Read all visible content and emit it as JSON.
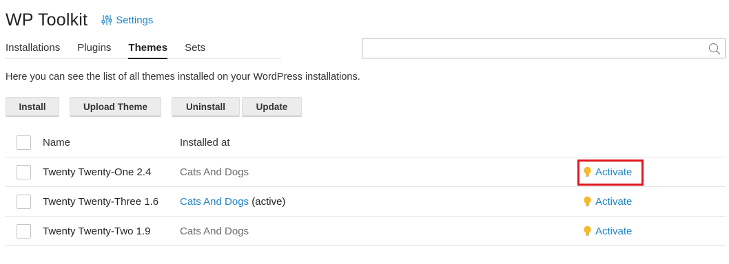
{
  "header": {
    "title": "WP Toolkit",
    "settings_label": "Settings"
  },
  "tabs": [
    {
      "label": "Installations",
      "active": false
    },
    {
      "label": "Plugins",
      "active": false
    },
    {
      "label": "Themes",
      "active": true
    },
    {
      "label": "Sets",
      "active": false
    }
  ],
  "search": {
    "value": "",
    "placeholder": ""
  },
  "description": "Here you can see the list of all themes installed on your WordPress installations.",
  "toolbar": {
    "install_label": "Install",
    "upload_label": "Upload Theme",
    "uninstall_label": "Uninstall",
    "update_label": "Update"
  },
  "table": {
    "columns": {
      "name": "Name",
      "installed_at": "Installed at"
    },
    "rows": [
      {
        "name": "Twenty Twenty-One 2.4",
        "installed_at": "Cats And Dogs",
        "installed_suffix": "",
        "action": "Activate"
      },
      {
        "name": "Twenty Twenty-Three 1.6",
        "installed_at": "Cats And Dogs",
        "installed_suffix": " (active)",
        "action": "Activate"
      },
      {
        "name": "Twenty Twenty-Two 1.9",
        "installed_at": "Cats And Dogs",
        "installed_suffix": "",
        "action": "Activate"
      }
    ]
  },
  "colors": {
    "link": "#1f87c7",
    "highlight": "#e0151b",
    "bulb": "#f5b82e"
  },
  "icons": {
    "settings": "sliders-icon",
    "search": "search-icon",
    "activate": "lightbulb-icon"
  }
}
